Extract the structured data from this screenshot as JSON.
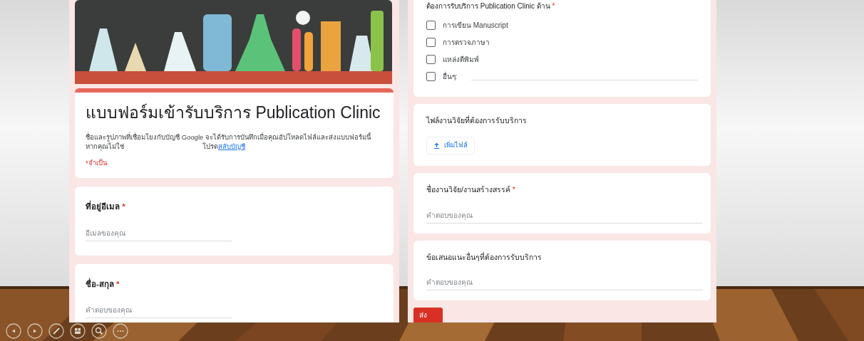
{
  "left_form": {
    "title": "แบบฟอร์มเข้ารับบริการ Publication Clinic",
    "account_notice": {
      "text": "ชื่อและรูปภาพที่เชื่อมโยงกับบัญชี Google จะได้รับการบันทึกเมื่อคุณอัปโหลดไฟล์และส่งแบบฟอร์มนี้",
      "prefix": "หากคุณไม่ใช่",
      "suffix": "โปรด",
      "link": "สลับบัญชี"
    },
    "required_note": "*จำเป็น",
    "questions": [
      {
        "label": "ที่อยู่อีเมล",
        "required_mark": "*",
        "placeholder": "อีเมลของคุณ"
      },
      {
        "label": "ชื่อ-สกุล",
        "required_mark": "*",
        "placeholder": "คำตอบของคุณ"
      }
    ]
  },
  "right_form": {
    "questions": [
      {
        "kind": "checkboxes",
        "label": "ต้องการรับบริการ Publication Clinic ด้าน",
        "required_mark": "*",
        "options": [
          {
            "label": "การเขียน Manuscript",
            "checked": false
          },
          {
            "label": "การตรวจภาษา",
            "checked": false
          },
          {
            "label": "แหล่งตีพิมพ์",
            "checked": false
          },
          {
            "label": "อื่นๆ:",
            "checked": false,
            "other_field": true
          }
        ]
      },
      {
        "kind": "file",
        "label": "ไฟล์งานวิจัยที่ต้องการรับบริการ",
        "button": "เพิ่มไฟล์"
      },
      {
        "kind": "text",
        "label": "ชื่องานวิจัย/งานสร้างสรรค์",
        "required_mark": "*",
        "placeholder": "คำตอบของคุณ"
      },
      {
        "kind": "text",
        "label": "ข้อเสนอแนะอื่นๆที่ต้องการรับบริการ",
        "placeholder": "คำตอบของคุณ"
      }
    ],
    "submit": "ส่ง"
  },
  "controls": [
    {
      "kind": "previous"
    },
    {
      "kind": "next"
    },
    {
      "kind": "pen"
    },
    {
      "kind": "slides"
    },
    {
      "kind": "zoom"
    },
    {
      "kind": "more"
    }
  ]
}
